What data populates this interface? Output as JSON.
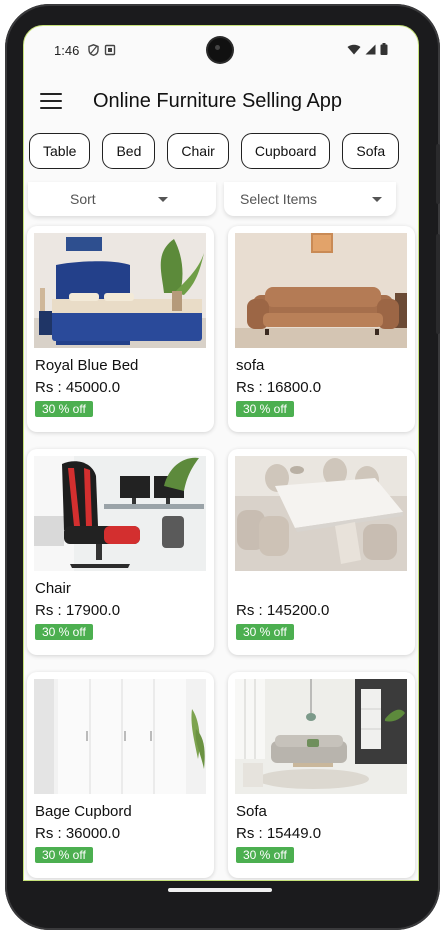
{
  "status": {
    "time": "1:46",
    "left_icons": [
      "shield-icon",
      "screenshot-icon"
    ],
    "right_icons": [
      "wifi-icon",
      "signal-icon",
      "battery-icon"
    ]
  },
  "appbar": {
    "title": "Online Furniture Selling App",
    "menu_icon": "hamburger-menu-icon"
  },
  "categories": [
    "Table",
    "Bed",
    "Chair",
    "Cupboard",
    "Sofa"
  ],
  "filters": {
    "sort_label": "Sort",
    "select_label": "Select Items"
  },
  "products": [
    {
      "name": "Royal Blue Bed",
      "price": "Rs : 45000.0",
      "discount": "30 % off",
      "image": "blue-bed"
    },
    {
      "name": "sofa",
      "price": "Rs : 16800.0",
      "discount": "30 % off",
      "image": "brown-sofa"
    },
    {
      "name": "Chair",
      "price": "Rs : 17900.0",
      "discount": "30 % off",
      "image": "gaming-chair"
    },
    {
      "name": "",
      "price": "Rs : 145200.0",
      "discount": "30 % off",
      "image": "dining-table"
    },
    {
      "name": "Bage Cupbord",
      "price": "Rs : 36000.0",
      "discount": "30 % off",
      "image": "white-cupboard"
    },
    {
      "name": "Sofa",
      "price": "Rs : 15449.0",
      "discount": "30 % off",
      "image": "living-room-sofa"
    }
  ],
  "colors": {
    "discount_badge": "#4caf50",
    "chip_border": "#222222",
    "screen_edge": "#c7e27a"
  }
}
